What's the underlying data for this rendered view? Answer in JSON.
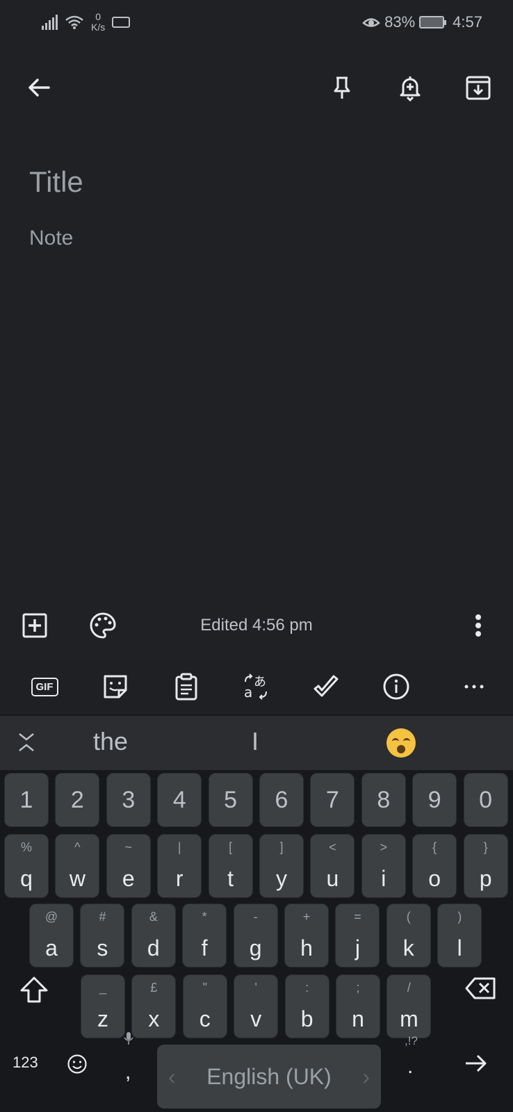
{
  "status_bar": {
    "net_speed_value": "0",
    "net_speed_unit": "K/s",
    "battery": "83%",
    "time": "4:57"
  },
  "toolbar": {
    "back_icon": "arrow-left-icon",
    "pin_icon": "pin-icon",
    "reminder_icon": "bell-plus-icon",
    "archive_icon": "archive-icon"
  },
  "editor": {
    "title_placeholder": "Title",
    "note_placeholder": "Note"
  },
  "bottom_bar": {
    "edited_label": "Edited 4:56 pm"
  },
  "keyboard": {
    "tools": {
      "gif_label": "GIF"
    },
    "suggestions": [
      "the",
      "I"
    ],
    "number_row": [
      "1",
      "2",
      "3",
      "4",
      "5",
      "6",
      "7",
      "8",
      "9",
      "0"
    ],
    "row1": [
      {
        "main": "q",
        "sub": "%"
      },
      {
        "main": "w",
        "sub": "^"
      },
      {
        "main": "e",
        "sub": "~"
      },
      {
        "main": "r",
        "sub": "|"
      },
      {
        "main": "t",
        "sub": "["
      },
      {
        "main": "y",
        "sub": "]"
      },
      {
        "main": "u",
        "sub": "<"
      },
      {
        "main": "i",
        "sub": ">"
      },
      {
        "main": "o",
        "sub": "{"
      },
      {
        "main": "p",
        "sub": "}"
      }
    ],
    "row2": [
      {
        "main": "a",
        "sub": "@"
      },
      {
        "main": "s",
        "sub": "#"
      },
      {
        "main": "d",
        "sub": "&"
      },
      {
        "main": "f",
        "sub": "*"
      },
      {
        "main": "g",
        "sub": "-"
      },
      {
        "main": "h",
        "sub": "+"
      },
      {
        "main": "j",
        "sub": "="
      },
      {
        "main": "k",
        "sub": "("
      },
      {
        "main": "l",
        "sub": ")"
      }
    ],
    "row3": [
      {
        "main": "z",
        "sub": "_"
      },
      {
        "main": "x",
        "sub": "£"
      },
      {
        "main": "c",
        "sub": "\""
      },
      {
        "main": "v",
        "sub": "'"
      },
      {
        "main": "b",
        "sub": ":"
      },
      {
        "main": "n",
        "sub": ";"
      },
      {
        "main": "m",
        "sub": "/"
      }
    ],
    "bottom": {
      "numbers_label": "123",
      "comma": ",",
      "space_label": "English (UK)",
      "punct_hint": ",!?",
      "period": "."
    }
  }
}
